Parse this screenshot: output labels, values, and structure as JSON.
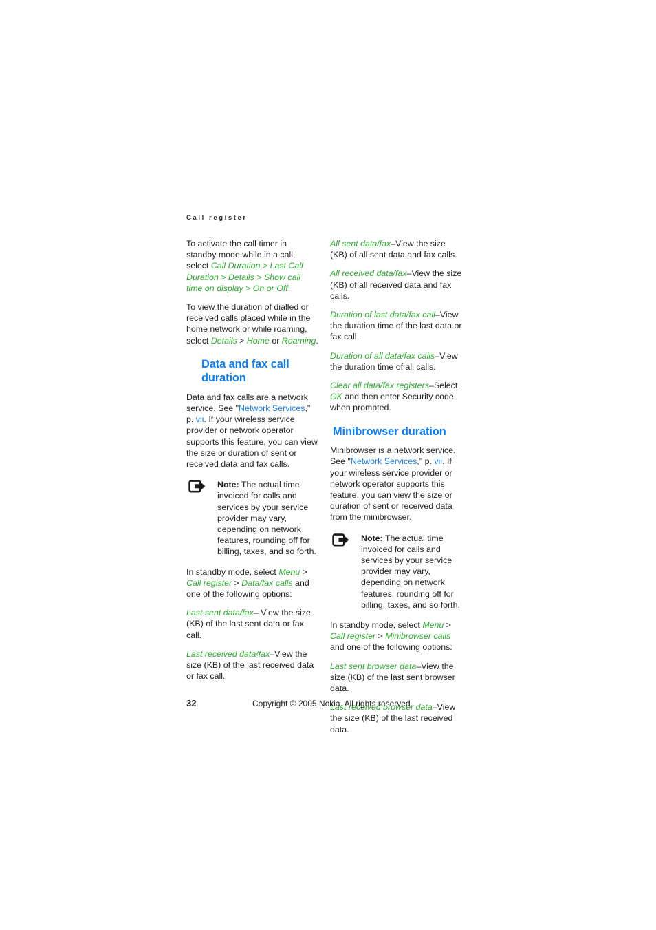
{
  "page": {
    "running_head": "Call register",
    "folio": "32",
    "copyright": "Copyright © 2005 Nokia. All rights reserved."
  },
  "colors": {
    "link_blue": "#1f7fe0",
    "heading_blue": "#117de6",
    "menu_green": "#31a733",
    "body_text": "#231f20"
  },
  "left_column": {
    "p1": {
      "lead": "To activate the call timer in standby mode while in a call, select ",
      "path": "Call Duration > Last Call Duration > Details > Show call time on display > On or Off",
      "tail": "."
    },
    "p2": {
      "lead": "To view the duration of dialled or received calls placed while in the home network or while roaming, select ",
      "path1": "Details",
      "sep1": " > ",
      "path2": "Home",
      "mid": " or ",
      "path3": "Roaming",
      "tail": "."
    },
    "heading": "Data and fax call duration",
    "p3": {
      "s1": "Data and fax calls are a network service. See \"",
      "link1": "Network Services",
      "s2": ",\" p. ",
      "link2": "vii",
      "s3": ". If your wireless service provider or network operator supports this feature, you can view the size or duration of sent or received data and fax calls."
    },
    "note": {
      "icon": "note-arrow-icon",
      "label": "Note:",
      "text": " The actual time invoiced for calls and services by your service provider may vary, depending on network features, rounding off for billing, taxes, and so forth."
    },
    "p4": {
      "lead": "In standby mode, select ",
      "path1": "Menu",
      "sep1": " > ",
      "path2": "Call register",
      "sep2": " > ",
      "path3": "Data/fax calls",
      "tail": " and one of the following options:"
    },
    "options": [
      {
        "term": "Last sent data/fax",
        "desc": "– View the size (KB) of the last sent data or fax call."
      },
      {
        "term": "Last received data/fax",
        "desc": "–View the size (KB) of the last received data or fax call."
      }
    ]
  },
  "right_column": {
    "options_top": [
      {
        "term": "All sent data/fax",
        "desc": "–View the size (KB) of all sent data and fax calls."
      },
      {
        "term": "All received data/fax",
        "desc": "–View the size (KB) of all received data and fax calls."
      },
      {
        "term": "Duration of last data/fax call",
        "desc": "–View the duration time of the last data or fax call."
      },
      {
        "term": "Duration of all data/fax calls",
        "desc": "–View the duration time of all calls."
      }
    ],
    "clear_option": {
      "term": "Clear all data/fax registers",
      "mid": "–Select ",
      "ok": "OK",
      "tail": " and then enter Security code when prompted."
    },
    "heading": "Minibrowser duration",
    "p1": {
      "s1": "Minibrowser is a network service. See \"",
      "link1": "Network Services",
      "s2": ",\" p. ",
      "link2": "vii",
      "s3": ". If your wireless service provider or network operator supports this feature, you can view the size or duration of sent or received data from the minibrowser."
    },
    "note": {
      "icon": "note-arrow-icon",
      "label": "Note:",
      "text": " The actual time invoiced for calls and services by your service provider may vary, depending on network features, rounding off for billing, taxes, and so forth."
    },
    "p2": {
      "lead": "In standby mode, select ",
      "path1": "Menu",
      "sep1": " > ",
      "path2": "Call register",
      "sep2": " > ",
      "path3": "Minibrowser calls",
      "tail": " and one of the following options:"
    },
    "options_bottom": [
      {
        "term": "Last sent browser data",
        "desc": "–View the size (KB) of the last sent browser data."
      },
      {
        "term": "Last received browser data",
        "desc": "–View the size (KB) of the last received data."
      }
    ]
  }
}
